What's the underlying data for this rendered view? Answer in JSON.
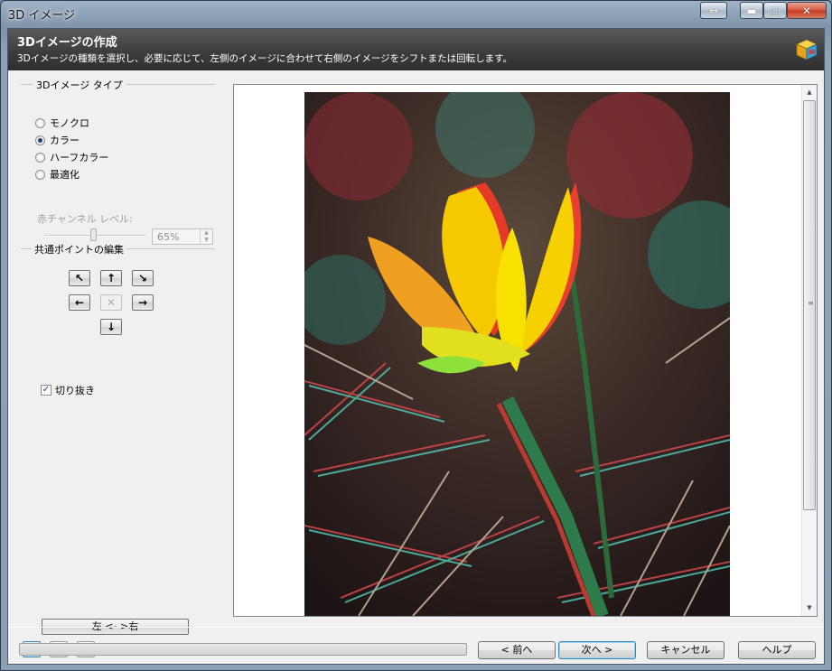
{
  "window": {
    "title": "3D イメージ"
  },
  "header": {
    "title": "3Dイメージの作成",
    "description": "3Dイメージの種類を選択し、必要に応じて、左側のイメージに合わせて右側のイメージをシフトまたは回転します。"
  },
  "type_group": {
    "label": "3Dイメージ タイプ",
    "options": [
      "モノクロ",
      "カラー",
      "ハーフカラー",
      "最適化"
    ],
    "selected": "カラー"
  },
  "red_channel": {
    "label": "赤チャンネル レベル:",
    "value": "65%",
    "level": 0.65
  },
  "edit_group": {
    "label": "共通ポイントの編集"
  },
  "crop": {
    "label": "切り抜き",
    "checked": true
  },
  "swap_button": "左 <- >右",
  "progress": 0,
  "footer": {
    "back": "< 前へ",
    "next": "次へ >",
    "cancel": "キャンセル",
    "help": "ヘルプ"
  },
  "colors": {
    "header_bg": "#3b3b3b",
    "accent": "#3c7fb1",
    "close_btn": "#c2391f"
  },
  "icons": [
    "resize-icon",
    "minimize-icon",
    "maximize-icon",
    "close-icon",
    "3d-cube-icon",
    "zoom-in-icon",
    "zoom-out-icon",
    "fit-icon"
  ]
}
